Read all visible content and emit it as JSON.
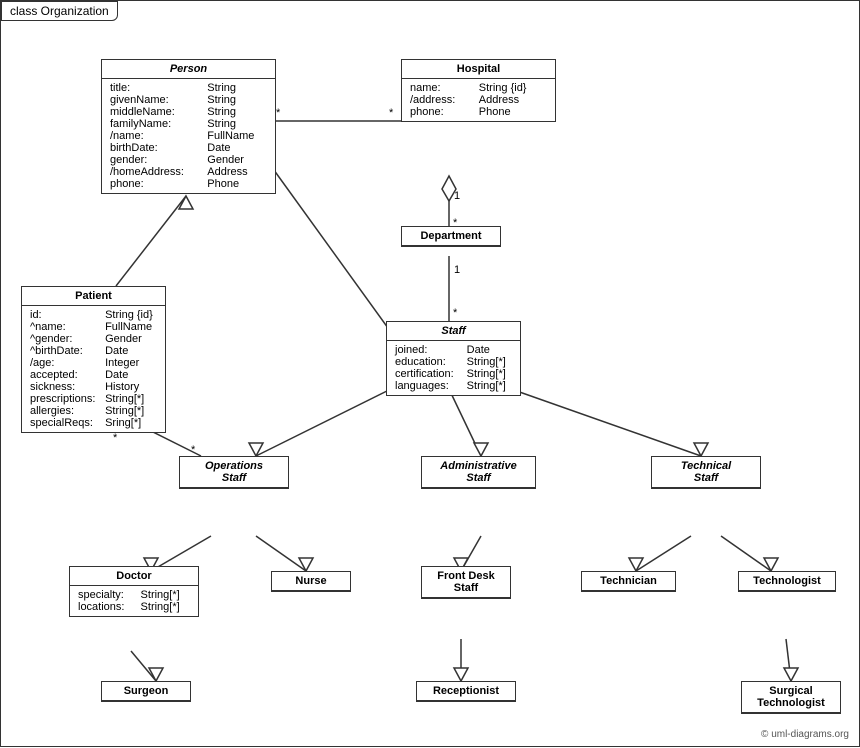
{
  "title": "class Organization",
  "copyright": "© uml-diagrams.org",
  "classes": {
    "person": {
      "name": "Person",
      "italic": true,
      "attributes": [
        {
          "name": "title:",
          "type": "String"
        },
        {
          "name": "givenName:",
          "type": "String"
        },
        {
          "name": "middleName:",
          "type": "String"
        },
        {
          "name": "familyName:",
          "type": "String"
        },
        {
          "name": "/name:",
          "type": "FullName"
        },
        {
          "name": "birthDate:",
          "type": "Date"
        },
        {
          "name": "gender:",
          "type": "Gender"
        },
        {
          "name": "/homeAddress:",
          "type": "Address"
        },
        {
          "name": "phone:",
          "type": "Phone"
        }
      ]
    },
    "hospital": {
      "name": "Hospital",
      "italic": false,
      "attributes": [
        {
          "name": "name:",
          "type": "String {id}"
        },
        {
          "name": "/address:",
          "type": "Address"
        },
        {
          "name": "phone:",
          "type": "Phone"
        }
      ]
    },
    "department": {
      "name": "Department",
      "italic": false,
      "attributes": []
    },
    "staff": {
      "name": "Staff",
      "italic": true,
      "attributes": [
        {
          "name": "joined:",
          "type": "Date"
        },
        {
          "name": "education:",
          "type": "String[*]"
        },
        {
          "name": "certification:",
          "type": "String[*]"
        },
        {
          "name": "languages:",
          "type": "String[*]"
        }
      ]
    },
    "patient": {
      "name": "Patient",
      "italic": false,
      "attributes": [
        {
          "name": "id:",
          "type": "String {id}"
        },
        {
          "name": "^name:",
          "type": "FullName"
        },
        {
          "name": "^gender:",
          "type": "Gender"
        },
        {
          "name": "^birthDate:",
          "type": "Date"
        },
        {
          "name": "/age:",
          "type": "Integer"
        },
        {
          "name": "accepted:",
          "type": "Date"
        },
        {
          "name": "sickness:",
          "type": "History"
        },
        {
          "name": "prescriptions:",
          "type": "String[*]"
        },
        {
          "name": "allergies:",
          "type": "String[*]"
        },
        {
          "name": "specialReqs:",
          "type": "Sring[*]"
        }
      ]
    },
    "operations_staff": {
      "name": "Operations\nStaff",
      "italic": true,
      "attributes": []
    },
    "administrative_staff": {
      "name": "Administrative\nStaff",
      "italic": true,
      "attributes": []
    },
    "technical_staff": {
      "name": "Technical\nStaff",
      "italic": true,
      "attributes": []
    },
    "doctor": {
      "name": "Doctor",
      "italic": false,
      "attributes": [
        {
          "name": "specialty:",
          "type": "String[*]"
        },
        {
          "name": "locations:",
          "type": "String[*]"
        }
      ]
    },
    "nurse": {
      "name": "Nurse",
      "italic": false,
      "attributes": []
    },
    "front_desk_staff": {
      "name": "Front Desk\nStaff",
      "italic": false,
      "attributes": []
    },
    "technician": {
      "name": "Technician",
      "italic": false,
      "attributes": []
    },
    "technologist": {
      "name": "Technologist",
      "italic": false,
      "attributes": []
    },
    "surgeon": {
      "name": "Surgeon",
      "italic": false,
      "attributes": []
    },
    "receptionist": {
      "name": "Receptionist",
      "italic": false,
      "attributes": []
    },
    "surgical_technologist": {
      "name": "Surgical\nTechnologist",
      "italic": false,
      "attributes": []
    }
  }
}
